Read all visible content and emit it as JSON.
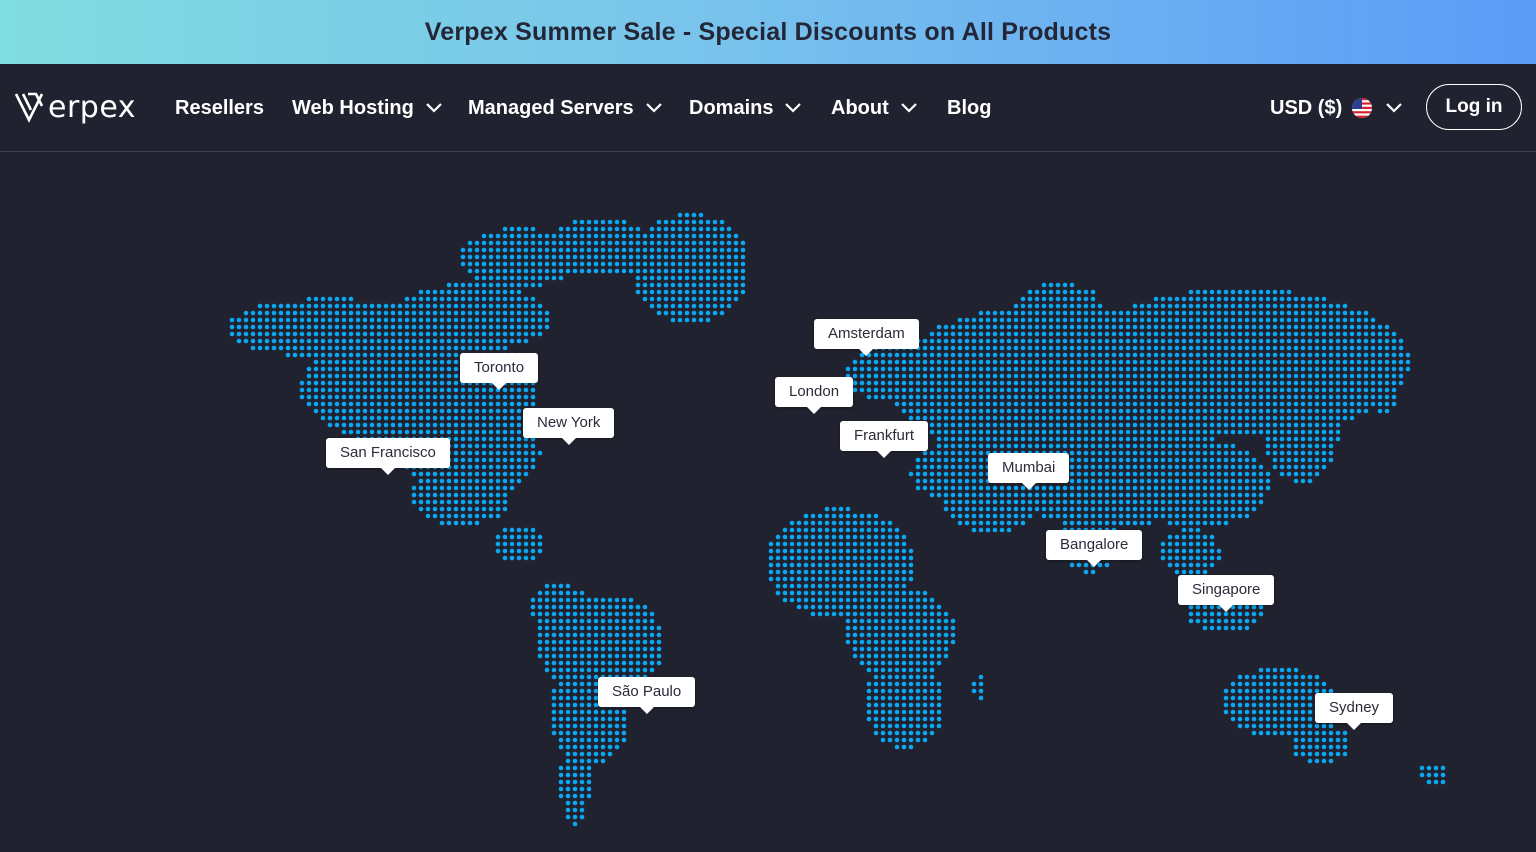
{
  "promo": {
    "text": "Verpex Summer Sale - Special Discounts on All Products"
  },
  "brand": {
    "logo_text": "erpex",
    "logo_icon": "verpex-v-logo-icon"
  },
  "nav": {
    "items": [
      {
        "label": "Resellers",
        "has_dropdown": false
      },
      {
        "label": "Web Hosting",
        "has_dropdown": true
      },
      {
        "label": "Managed Servers",
        "has_dropdown": true
      },
      {
        "label": "Domains",
        "has_dropdown": true
      },
      {
        "label": "About",
        "has_dropdown": true
      },
      {
        "label": "Blog",
        "has_dropdown": false
      }
    ],
    "currency": {
      "label": "USD ($)",
      "flag_icon": "us-flag-icon"
    },
    "login_label": "Log in"
  },
  "map": {
    "dot_color": "#0aa8f2",
    "locations": [
      {
        "name": "Toronto"
      },
      {
        "name": "New York"
      },
      {
        "name": "San Francisco"
      },
      {
        "name": "São Paulo"
      },
      {
        "name": "Amsterdam"
      },
      {
        "name": "London"
      },
      {
        "name": "Frankfurt"
      },
      {
        "name": "Mumbai"
      },
      {
        "name": "Bangalore"
      },
      {
        "name": "Singapore"
      },
      {
        "name": "Sydney"
      }
    ]
  },
  "colors": {
    "background": "#21222f",
    "promo_gradient_start": "#7fdcdf",
    "promo_gradient_end": "#5c9bf7",
    "promo_text": "#232636",
    "map_dot": "#0aa8f2"
  }
}
